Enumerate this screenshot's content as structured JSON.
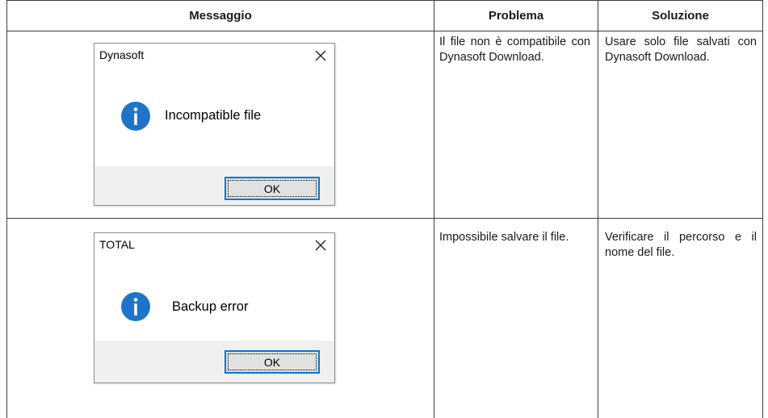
{
  "table": {
    "headers": {
      "message": "Messaggio",
      "problem": "Problema",
      "solution": "Soluzione"
    },
    "rows": [
      {
        "dialog": {
          "title": "Dynasoft",
          "message": "Incompatible file",
          "ok_label": "OK",
          "icon": "info-icon",
          "close_icon": "close-icon"
        },
        "problem": "Il file non è compatibile con Dynasoft Download.",
        "solution": "Usare solo file salvati con Dynasoft Download."
      },
      {
        "dialog": {
          "title": "TOTAL",
          "message": "Backup error",
          "ok_label": "OK",
          "icon": "info-icon",
          "close_icon": "close-icon"
        },
        "problem": "Impossibile salvare il file.",
        "solution": "Verificare il percorso e il nome del file."
      }
    ]
  },
  "colors": {
    "accent": "#0078d7",
    "info_icon": "#1e74c8",
    "footer": "#f0f0f0"
  }
}
